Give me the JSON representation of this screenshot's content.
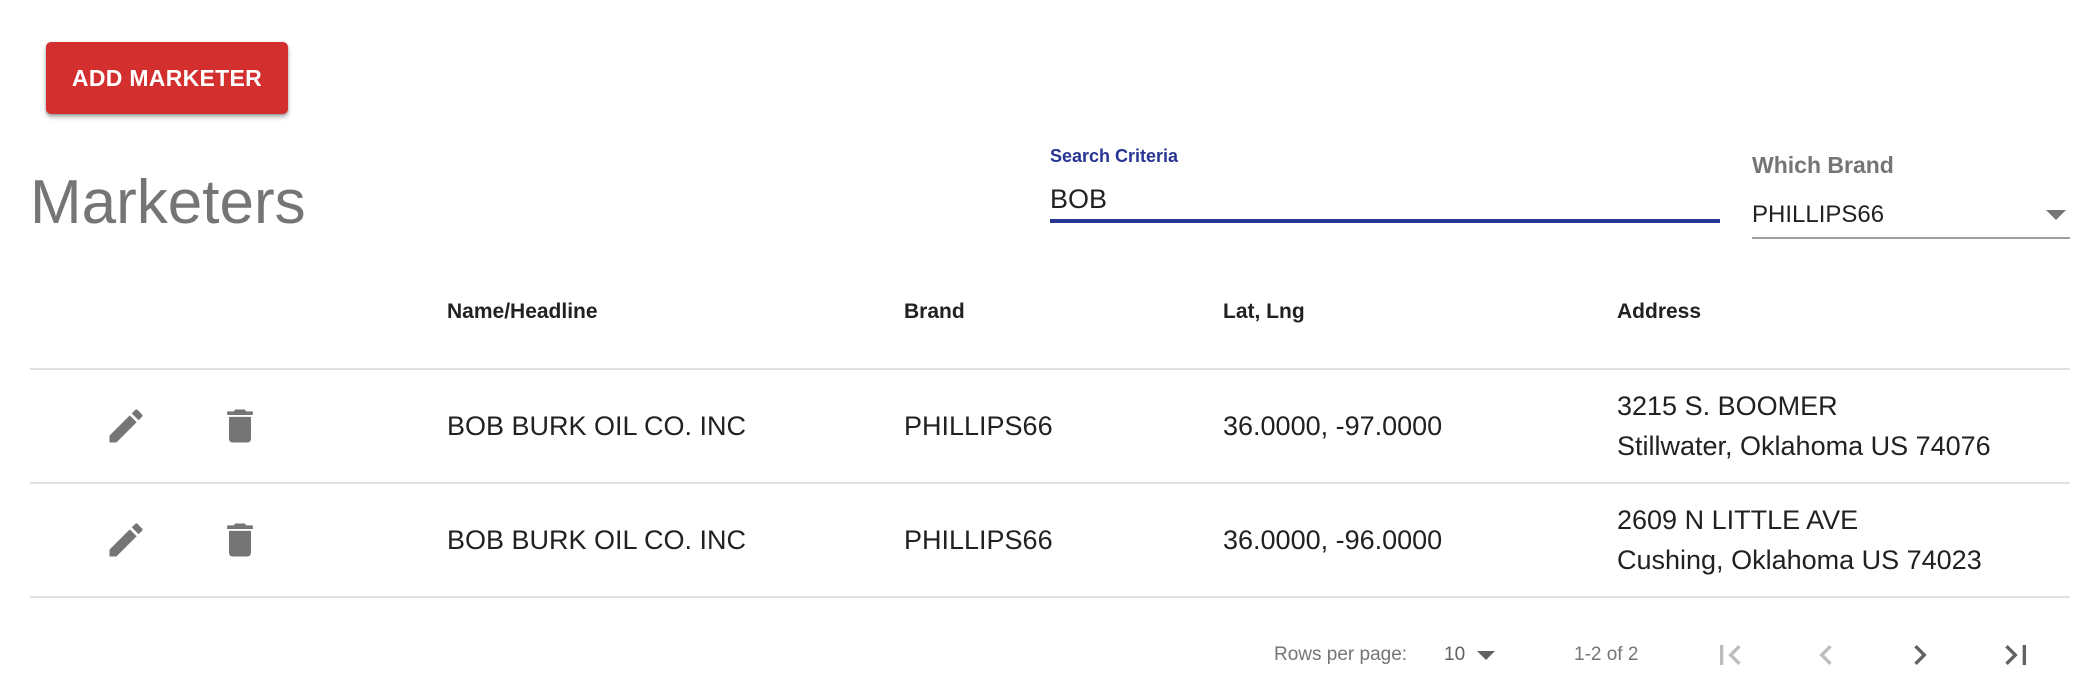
{
  "toolbar": {
    "add_label": "ADD MARKETER"
  },
  "page": {
    "title": "Marketers"
  },
  "search": {
    "label": "Search Criteria",
    "value": "BOB"
  },
  "brand_filter": {
    "label": "Which Brand",
    "selected": "PHILLIPS66"
  },
  "table": {
    "columns": [
      "",
      "",
      "Name/Headline",
      "Brand",
      "Lat, Lng",
      "Address"
    ],
    "rows": [
      {
        "name": "BOB BURK OIL CO. INC",
        "brand": "PHILLIPS66",
        "latlng": "36.0000, -97.0000",
        "address_line1": "3215 S. BOOMER",
        "address_line2": "Stillwater, Oklahoma US 74076"
      },
      {
        "name": "BOB BURK OIL CO. INC",
        "brand": "PHILLIPS66",
        "latlng": "36.0000, -96.0000",
        "address_line1": "2609 N LITTLE AVE",
        "address_line2": "Cushing, Oklahoma US 74023"
      }
    ]
  },
  "pagination": {
    "rows_per_page_label": "Rows per page:",
    "rows_per_page": "10",
    "range": "1-2 of 2"
  },
  "icons": {
    "edit": "pencil-icon",
    "delete": "trash-icon",
    "first": "first-page-icon",
    "prev": "chevron-left-icon",
    "next": "chevron-right-icon",
    "last": "last-page-icon"
  },
  "colors": {
    "accent_red": "#d32f2f",
    "accent_blue": "#283593",
    "muted": "#757575",
    "disabled": "#bdbdbd",
    "divider": "#e0e0e0"
  }
}
